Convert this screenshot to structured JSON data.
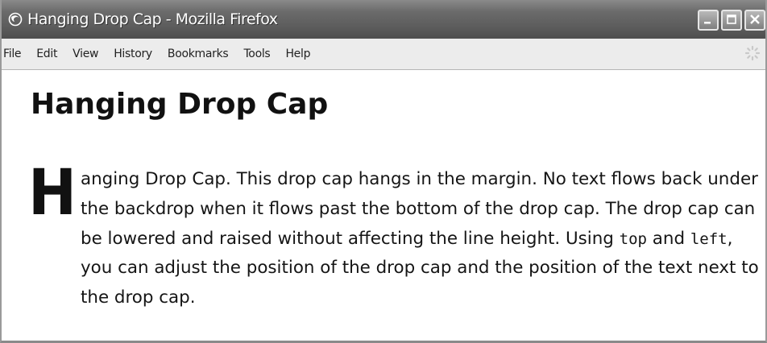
{
  "window": {
    "title": "Hanging Drop Cap - Mozilla Firefox"
  },
  "menubar": {
    "items": [
      "File",
      "Edit",
      "View",
      "History",
      "Bookmarks",
      "Tools",
      "Help"
    ]
  },
  "page": {
    "heading": "Hanging Drop Cap",
    "drop_cap": "H",
    "text_before_top": "anging Drop Cap. This drop cap hangs in the margin. No text flows back under the backdrop when it flows past the bottom of the drop cap. The drop cap can be lowered and raised without affecting the line height. Using ",
    "code_top": "top",
    "text_and": " and ",
    "code_left": "left",
    "text_after_left": ", you can adjust the position of the drop cap and the position of the text next to the drop cap."
  },
  "icons": {
    "app": "firefox-icon",
    "minimize": "minimize-icon",
    "maximize": "maximize-icon",
    "close": "close-icon",
    "throbber": "throbber-icon"
  },
  "colors": {
    "titlebar": "#5c5c5c",
    "menubar": "#ececec",
    "text": "#151515"
  }
}
